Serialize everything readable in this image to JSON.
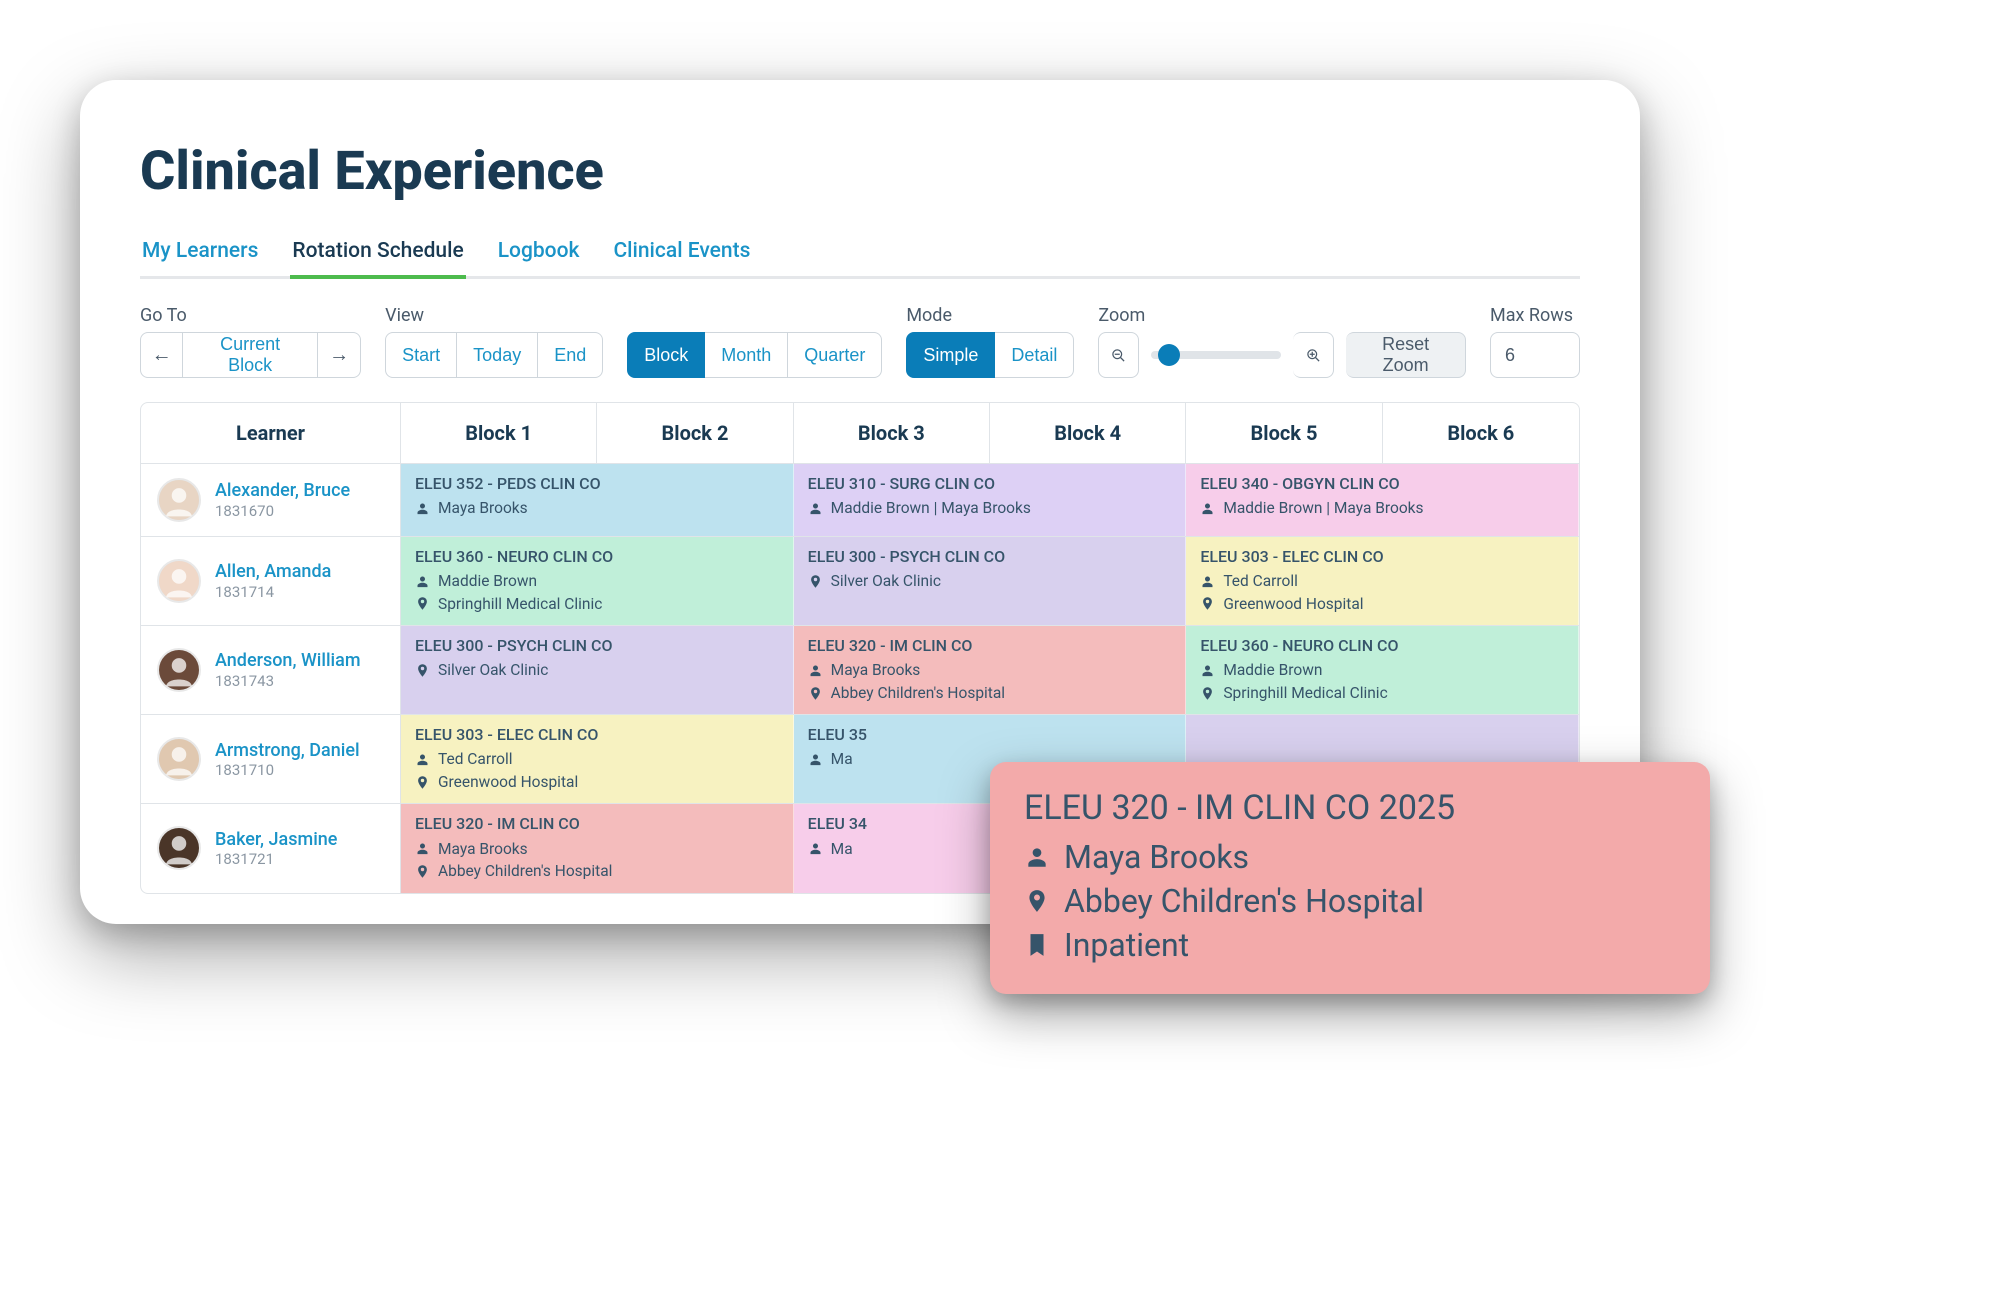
{
  "page": {
    "title": "Clinical Experience"
  },
  "tabs": [
    "My Learners",
    "Rotation Schedule",
    "Logbook",
    "Clinical Events"
  ],
  "active_tab": "Rotation Schedule",
  "toolbar": {
    "goto_label": "Go To",
    "current_block": "Current Block",
    "view_label": "View",
    "start": "Start",
    "today": "Today",
    "end": "End",
    "block": "Block",
    "month": "Month",
    "quarter": "Quarter",
    "mode_label": "Mode",
    "simple": "Simple",
    "detail": "Detail",
    "zoom_label": "Zoom",
    "reset_zoom": "Reset Zoom",
    "maxrows_label": "Max Rows",
    "maxrows_value": "6"
  },
  "columns": [
    "Learner",
    "Block 1",
    "Block 2",
    "Block 3",
    "Block 4",
    "Block 5",
    "Block 6"
  ],
  "avatar_bg": [
    "#e8d5c4",
    "#f0d8c8",
    "#6b4a3a",
    "#e0c8b0",
    "#4a3528"
  ],
  "learners": [
    {
      "name": "Alexander, Bruce",
      "id": "1831670",
      "blocks": [
        {
          "span": 2,
          "color": "c-blue",
          "course": "ELEU 352 - PEDS CLIN CO",
          "person": "Maya Brooks"
        },
        {
          "span": 2,
          "color": "c-purple",
          "course": "ELEU 310 - SURG CLIN CO",
          "person": "Maddie Brown  |  Maya Brooks"
        },
        {
          "span": 2,
          "color": "c-pink",
          "course": "ELEU 340 - OBGYN CLIN CO",
          "person": "Maddie Brown  |  Maya Brooks"
        }
      ]
    },
    {
      "name": "Allen, Amanda",
      "id": "1831714",
      "blocks": [
        {
          "span": 2,
          "color": "c-green",
          "course": "ELEU 360 - NEURO CLIN CO",
          "person": "Maddie Brown",
          "location": "Springhill Medical Clinic"
        },
        {
          "span": 2,
          "color": "c-purple-light",
          "course": "ELEU 300 - PSYCH CLIN CO",
          "location": "Silver Oak Clinic"
        },
        {
          "span": 2,
          "color": "c-yellow",
          "course": "ELEU 303 - ELEC CLIN CO",
          "person": "Ted Carroll",
          "location": "Greenwood Hospital"
        }
      ]
    },
    {
      "name": "Anderson, William",
      "id": "1831743",
      "blocks": [
        {
          "span": 2,
          "color": "c-purple-light",
          "course": "ELEU 300 -  PSYCH CLIN CO",
          "location": "Silver Oak Clinic"
        },
        {
          "span": 2,
          "color": "c-red",
          "course": "ELEU 320 - IM CLIN CO",
          "person": "Maya Brooks",
          "location": "Abbey Children's Hospital"
        },
        {
          "span": 2,
          "color": "c-green",
          "course": "ELEU 360 - NEURO CLIN CO",
          "person": "Maddie Brown",
          "location": "Springhill Medical Clinic"
        }
      ]
    },
    {
      "name": "Armstrong, Daniel",
      "id": "1831710",
      "blocks": [
        {
          "span": 2,
          "color": "c-yellow",
          "course": "ELEU 303 - ELEC CLIN CO",
          "person": "Ted Carroll",
          "location": "Greenwood Hospital"
        },
        {
          "span": 2,
          "color": "c-blue",
          "course": "ELEU 35",
          "person": "Ma",
          "truncated": true
        },
        {
          "span": 2,
          "color": "c-purple-light",
          "course": "",
          "truncated": true
        }
      ]
    },
    {
      "name": "Baker, Jasmine",
      "id": "1831721",
      "blocks": [
        {
          "span": 2,
          "color": "c-red",
          "course": "ELEU 320 - IM CLIN CO",
          "person": "Maya Brooks",
          "location": "Abbey Children's Hospital"
        },
        {
          "span": 2,
          "color": "c-pink",
          "course": "ELEU 34",
          "person": "Ma",
          "truncated": true
        },
        {
          "span": 0
        }
      ]
    }
  ],
  "tooltip": {
    "title": "ELEU 320 - IM CLIN CO 2025",
    "person": "Maya Brooks",
    "location": "Abbey Children's Hospital",
    "tag": "Inpatient"
  }
}
